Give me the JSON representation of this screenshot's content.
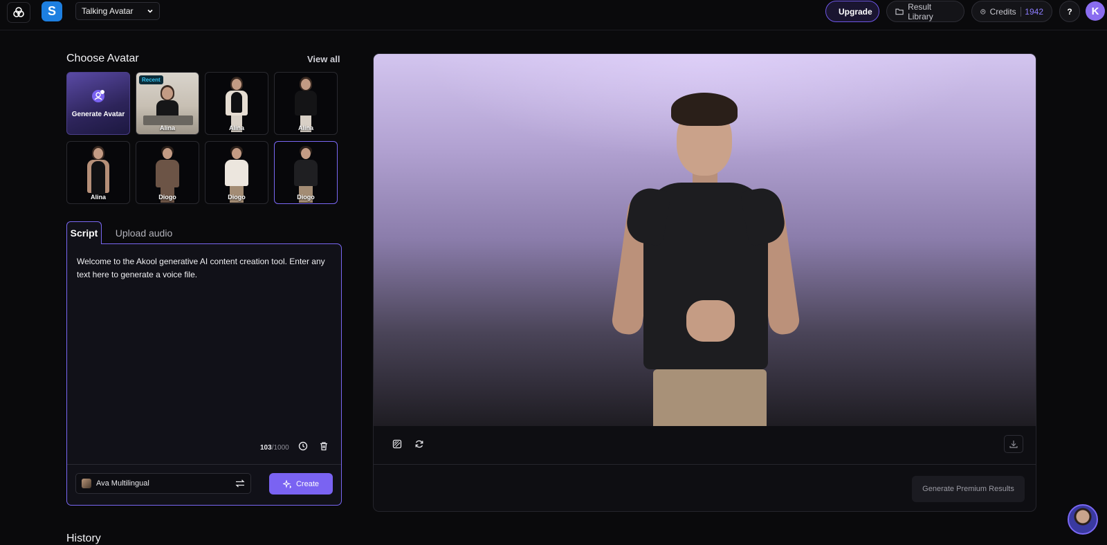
{
  "topbar": {
    "tool_select": "Talking Avatar",
    "upgrade": "Upgrade",
    "result_library": "Result Library",
    "credits_label": "Credits",
    "credits_value": "1942",
    "help": "?",
    "user_initial": "K",
    "app_letter": "S"
  },
  "avatars": {
    "title": "Choose Avatar",
    "view_all": "View all",
    "generate_label": "Generate Avatar",
    "recent_badge": "Recent",
    "tiles": [
      {
        "name": "Alina"
      },
      {
        "name": "Alina"
      },
      {
        "name": "Alina"
      },
      {
        "name": "Alina"
      },
      {
        "name": "Diogo"
      },
      {
        "name": "Diogo"
      },
      {
        "name": "Diogo"
      }
    ]
  },
  "script": {
    "tab_script": "Script",
    "tab_upload": "Upload audio",
    "text": "Welcome to the Akool generative AI content creation tool. Enter any text here to generate a voice file.",
    "count": "103",
    "max": "/1000",
    "voice": "Ava Multilingual",
    "create": "Create"
  },
  "preview": {
    "premium_button": "Generate Premium Results"
  },
  "history": {
    "title": "History"
  },
  "colors": {
    "accent": "#7a63f2",
    "background": "#0a0a0c",
    "app_blue": "#1d7fe0",
    "recent_badge": "#36c3f0"
  }
}
